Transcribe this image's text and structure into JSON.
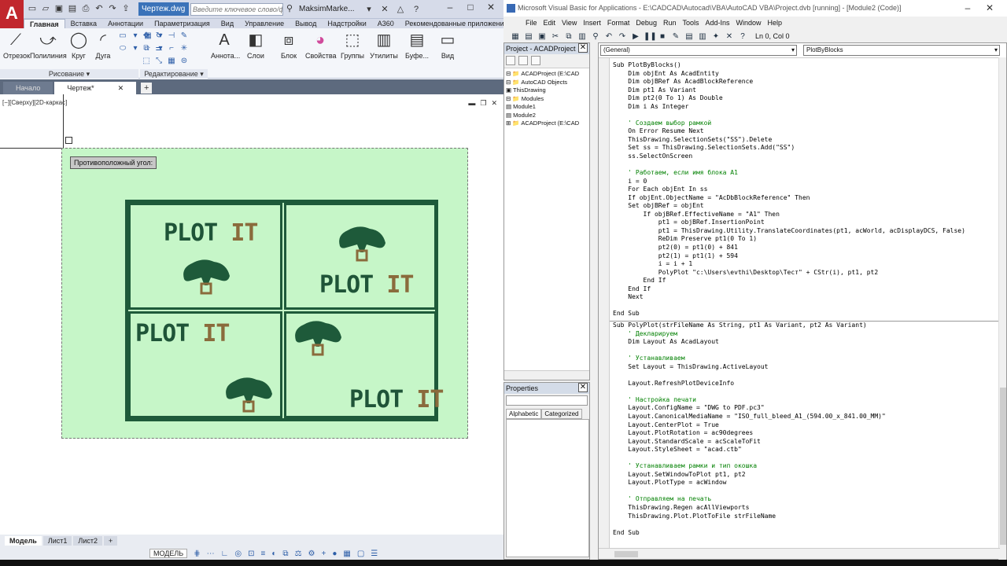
{
  "autocad": {
    "logo": "A",
    "filename": "Чертеж.dwg",
    "search_placeholder": "Введите ключевое слово/фразу",
    "user": "MaksimMarke...",
    "tabs": [
      "Главная",
      "Вставка",
      "Аннотации",
      "Параметризация",
      "Вид",
      "Управление",
      "Вывод",
      "Надстройки",
      "A360",
      "Рекомендованные приложения"
    ],
    "tools": {
      "line": "Отрезок",
      "polyline": "Полилиния",
      "circle": "Круг",
      "arc": "Дуга",
      "annotate": "Аннота...",
      "layers": "Слои",
      "block": "Блок",
      "properties": "Свойства",
      "groups": "Группы",
      "utilities": "Утилиты",
      "clipboard": "Буфе...",
      "view": "Вид"
    },
    "panel_draw": "Рисование ▾",
    "panel_edit": "Редактирование ▾",
    "doc_tabs": {
      "start": "Начало",
      "drawing": "Чертеж*"
    },
    "viewport_label": "[−][Сверху][2D-каркас]",
    "tooltip": "Противоположный угол:",
    "plot_text": {
      "plot": "PLOT",
      "it": "IT"
    },
    "layout_tabs": [
      "Модель",
      "Лист1",
      "Лист2"
    ],
    "status_model": "МОДЕЛЬ"
  },
  "vba": {
    "title": "Microsoft Visual Basic for Applications - E:\\CADCAD\\Autocad\\VBA\\AutoCAD VBA\\Project.dvb [running] - [Module2 (Code)]",
    "menu": [
      "File",
      "Edit",
      "View",
      "Insert",
      "Format",
      "Debug",
      "Run",
      "Tools",
      "Add-Ins",
      "Window",
      "Help"
    ],
    "cursor_pos": "Ln 0, Col 0",
    "project_title": "Project - ACADProject",
    "tree": [
      "⊟ 📁 ACADProject (E:\\CAD",
      "   ⊟ 📁 AutoCAD Objects",
      "        ▣ ThisDrawing",
      "   ⊟ 📁 Modules",
      "        ▤ Module1",
      "        ▤ Module2",
      "⊞ 📁 ACADProject (E:\\CAD"
    ],
    "properties_title": "Properties",
    "prop_tabs": [
      "Alphabetic",
      "Categorized"
    ],
    "dd_general": "(General)",
    "dd_proc": "PlotByBlocks",
    "code_block1": "Sub PlotByBlocks()\n    Dim objEnt As AcadEntity\n    Dim objBRef As AcadBlockReference\n    Dim pt1 As Variant\n    Dim pt2(0 To 1) As Double\n    Dim i As Integer\n\n    ' Создаем выбор рамкой\n    On Error Resume Next\n    ThisDrawing.SelectionSets(\"SS\").Delete\n    Set ss = ThisDrawing.SelectionSets.Add(\"SS\")\n    ss.SelectOnScreen\n\n    ' Работаем, если имя блока А1\n    i = 0\n    For Each objEnt In ss\n    If objEnt.ObjectName = \"AcDbBlockReference\" Then\n    Set objBRef = objEnt\n        If objBRef.EffectiveName = \"A1\" Then\n            pt1 = objBRef.InsertionPoint\n            pt1 = ThisDrawing.Utility.TranslateCoordinates(pt1, acWorld, acDisplayDCS, False)\n            ReDim Preserve pt1(0 To 1)\n            pt2(0) = pt1(0) + 841\n            pt2(1) = pt1(1) + 594\n            i = i + 1\n            PolyPlot \"c:\\Users\\evthi\\Desktop\\Тест\" + CStr(i), pt1, pt2\n        End If\n    End If\n    Next\n\nEnd Sub",
    "code_block2": "Sub PolyPlot(strFileName As String, pt1 As Variant, pt2 As Variant)\n    ' Декларируем\n    Dim Layout As AcadLayout\n\n    ' Устанавливаем\n    Set Layout = ThisDrawing.ActiveLayout\n\n    Layout.RefreshPlotDeviceInfo\n\n    ' Настройка печати\n    Layout.ConfigName = \"DWG to PDF.pc3\"\n    Layout.CanonicalMediaName = \"ISO_full_bleed_A1_(594.00_x_841.00_MM)\"\n    Layout.CenterPlot = True\n    Layout.PlotRotation = ac90degrees\n    Layout.StandardScale = acScaleToFit\n    Layout.StyleSheet = \"acad.ctb\"\n\n    ' Устанавливаем рамки и тип окошка\n    Layout.SetWindowToPlot pt1, pt2\n    Layout.PlotType = acWindow\n\n    ' Отправляем на печать\n    ThisDrawing.Regen acAllViewports\n    ThisDrawing.Plot.PlotToFile strFileName\n\nEnd Sub"
  }
}
